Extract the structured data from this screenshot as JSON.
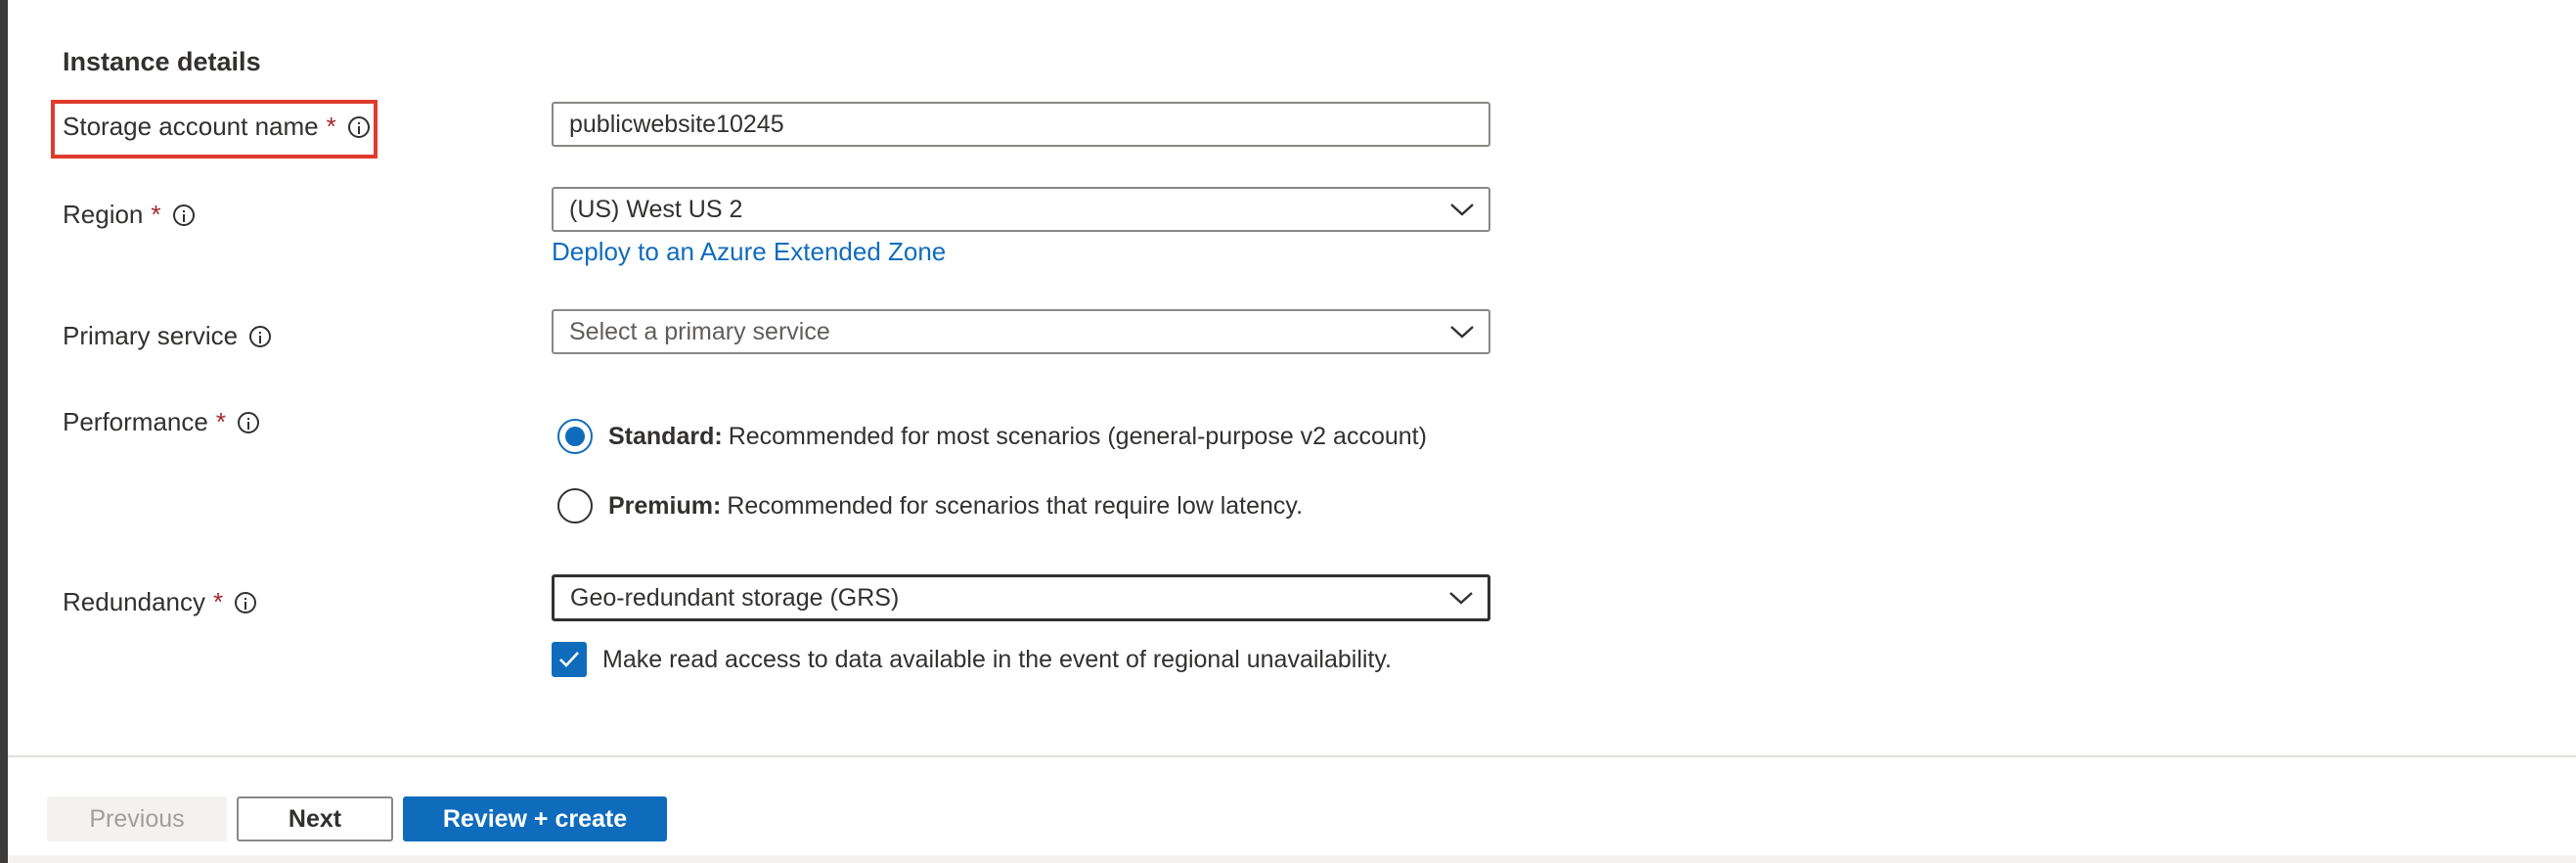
{
  "section": {
    "title": "Instance details"
  },
  "fields": {
    "storage_name": {
      "label": "Storage account name",
      "required": "*",
      "value": "publicwebsite10245"
    },
    "region": {
      "label": "Region",
      "required": "*",
      "value": "(US) West US 2",
      "link": "Deploy to an Azure Extended Zone"
    },
    "primary_service": {
      "label": "Primary service",
      "placeholder": "Select a primary service"
    },
    "performance": {
      "label": "Performance",
      "required": "*",
      "options": [
        {
          "title": "Standard:",
          "desc": "Recommended for most scenarios (general-purpose v2 account)",
          "checked": true
        },
        {
          "title": "Premium:",
          "desc": "Recommended for scenarios that require low latency.",
          "checked": false
        }
      ]
    },
    "redundancy": {
      "label": "Redundancy",
      "required": "*",
      "value": "Geo-redundant storage (GRS)",
      "checkbox_label": "Make read access to data available in the event of regional unavailability.",
      "checkbox_checked": true
    }
  },
  "footer": {
    "previous": "Previous",
    "next": "Next",
    "review": "Review + create"
  },
  "colors": {
    "accent": "#0f6cbd",
    "highlight": "#e03b2c",
    "required": "#a4262c"
  },
  "icons": [
    "info-icon",
    "chevron-down-icon",
    "checkmark-icon"
  ]
}
